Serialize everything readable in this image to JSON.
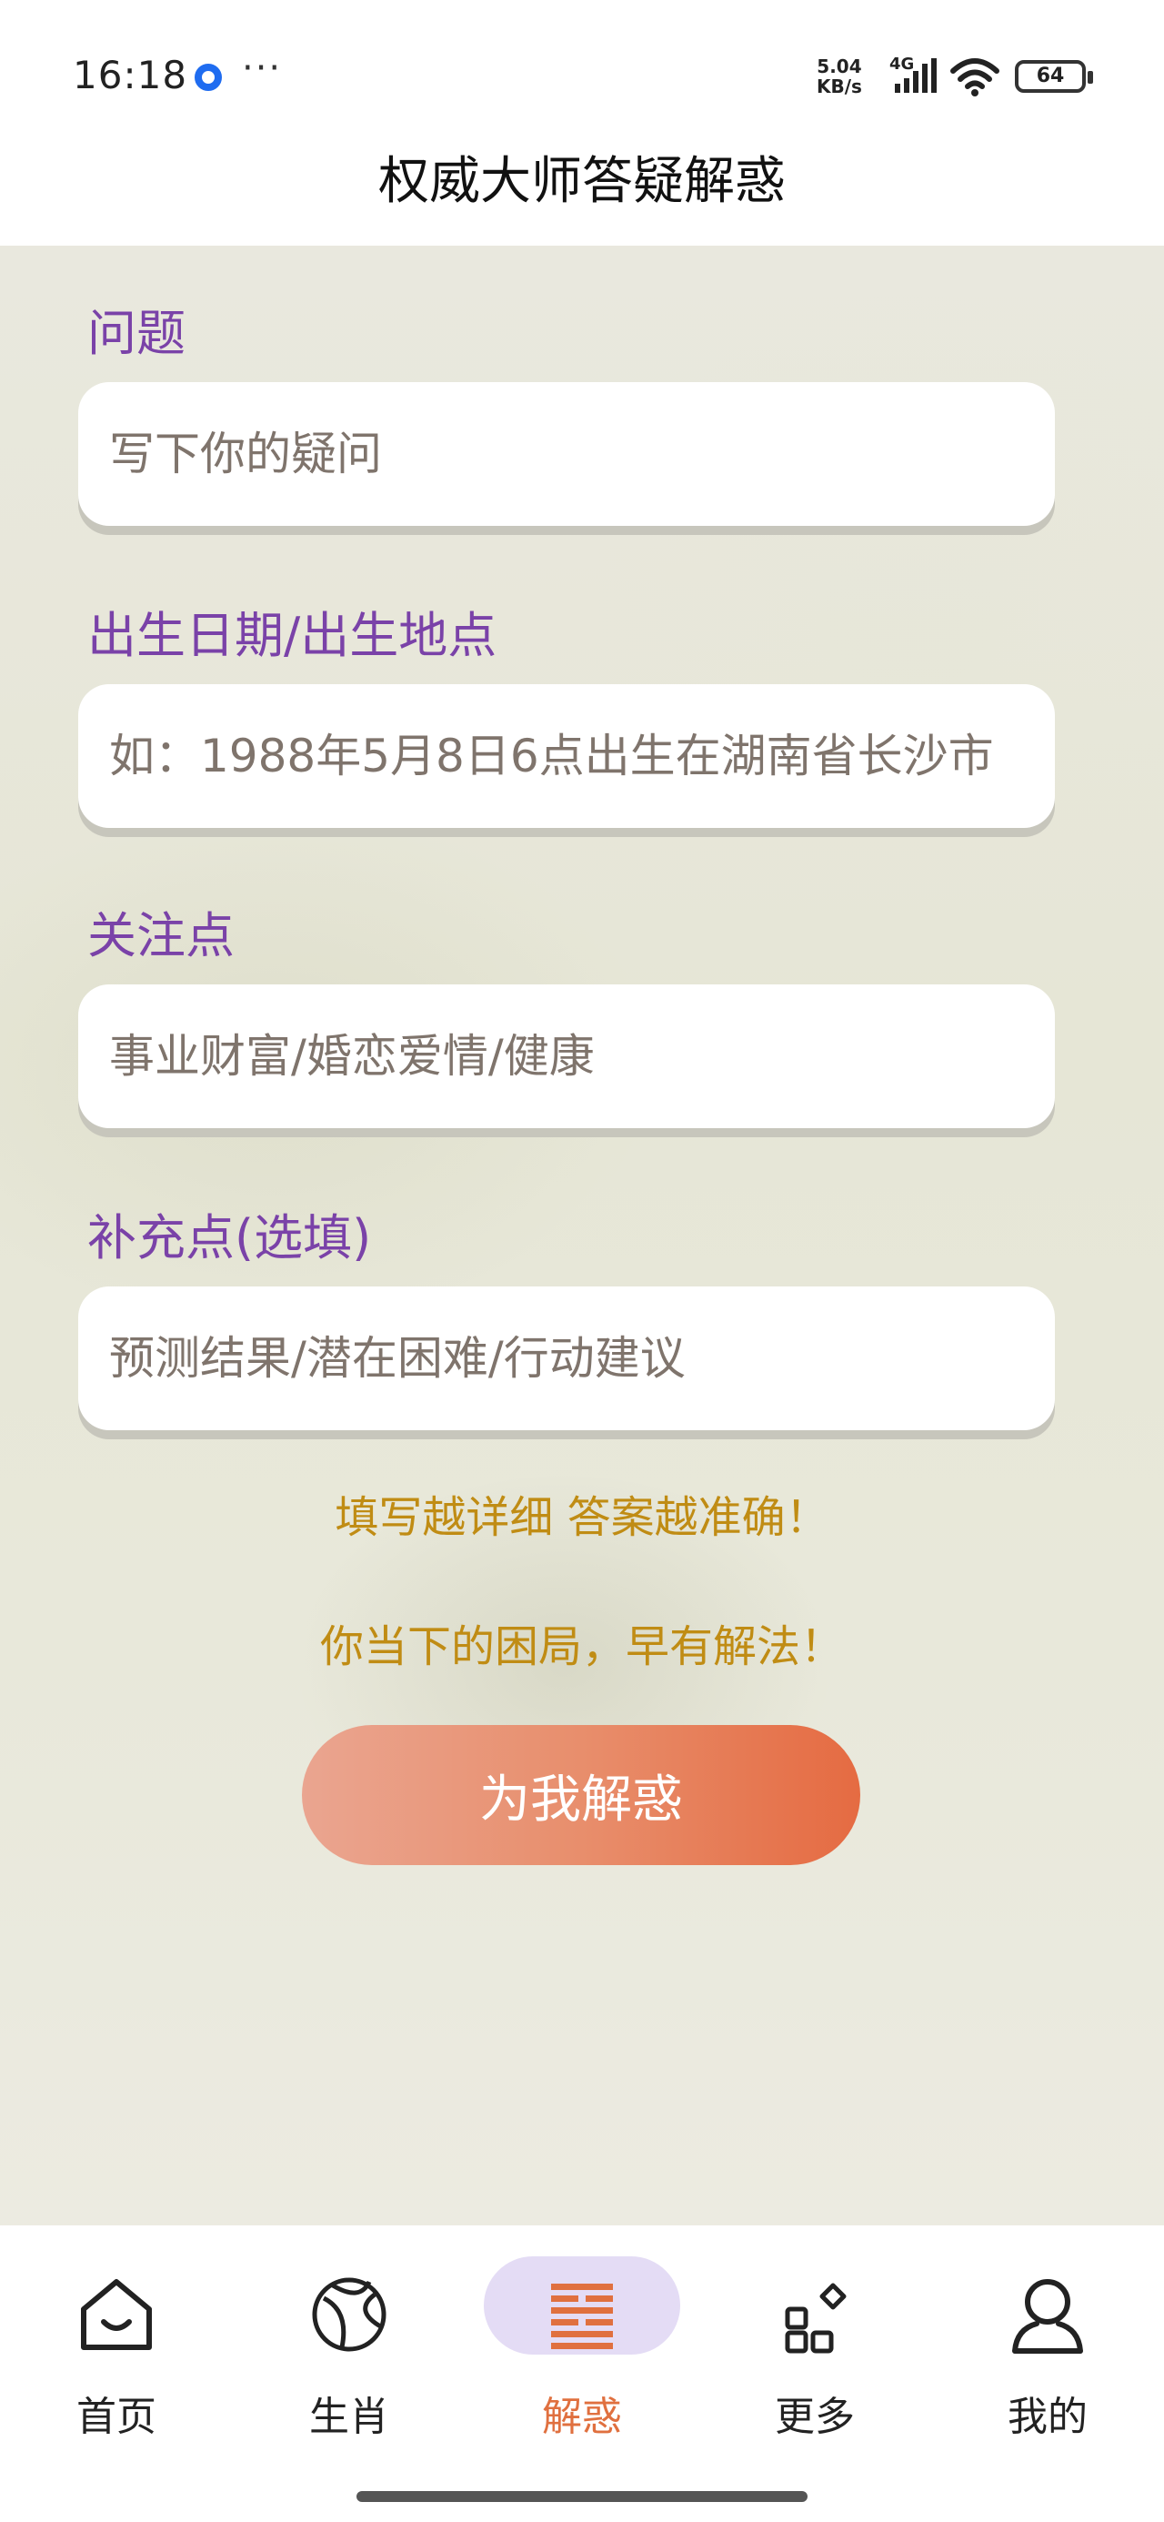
{
  "status_bar": {
    "time": "16:18",
    "dots": "···",
    "speed_top": "5.04",
    "speed_unit": "KB/s",
    "network": "4G",
    "battery": "64"
  },
  "header": {
    "title": "权威大师答疑解惑"
  },
  "form": {
    "question": {
      "label": "问题",
      "placeholder": "写下你的疑问"
    },
    "birth": {
      "label": "出生日期/出生地点",
      "placeholder": "如：1988年5月8日6点出生在湖南省长沙市"
    },
    "focus": {
      "label": "关注点",
      "placeholder": "事业财富/婚恋爱情/健康"
    },
    "supplement": {
      "label": "补充点(选填)",
      "placeholder": "预测结果/潜在困难/行动建议"
    }
  },
  "hints": {
    "line1": "填写越详细 答案越准确！",
    "line2": "你当下的困局，早有解法！"
  },
  "submit_label": "为我解惑",
  "nav": {
    "items": [
      {
        "label": "首页",
        "icon": "home-icon"
      },
      {
        "label": "生肖",
        "icon": "zodiac-icon"
      },
      {
        "label": "解惑",
        "icon": "hexagram-icon",
        "active": true
      },
      {
        "label": "更多",
        "icon": "apps-icon"
      },
      {
        "label": "我的",
        "icon": "profile-icon"
      }
    ]
  },
  "colors": {
    "label": "#7a42a8",
    "hint": "#c08c14",
    "accent": "#e56b42",
    "active_pill": "#e4dcf5"
  }
}
